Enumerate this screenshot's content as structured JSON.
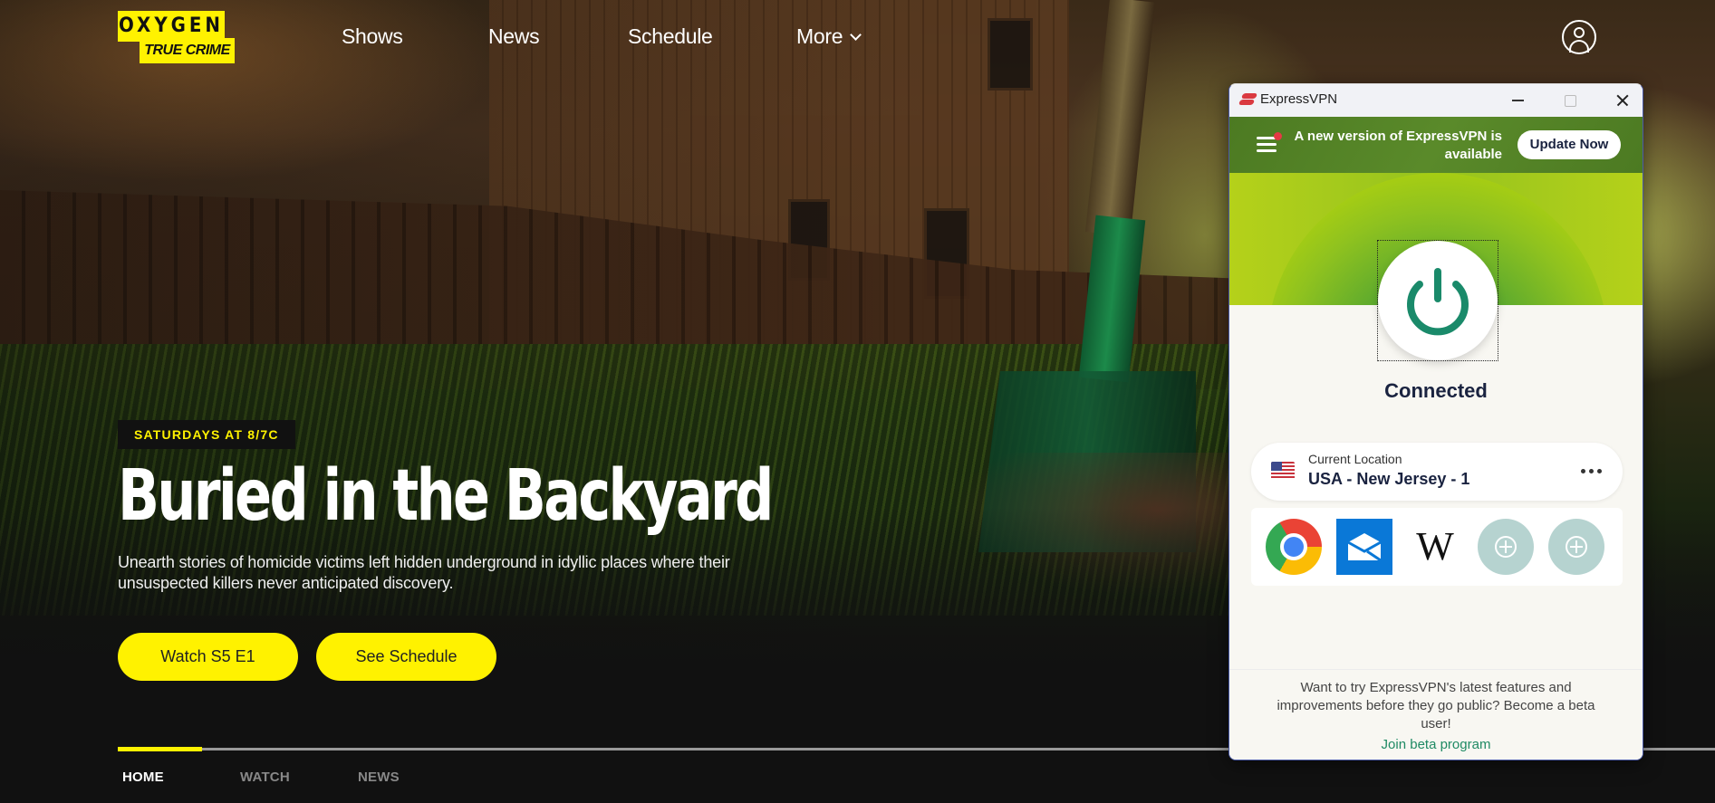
{
  "site": {
    "logo": {
      "line1": "OXYGEN",
      "line2": "TRUE CRIME",
      "color": "#fff200"
    },
    "nav": [
      {
        "label": "Shows"
      },
      {
        "label": "News"
      },
      {
        "label": "Schedule"
      },
      {
        "label": "More",
        "has_dropdown": true
      }
    ],
    "profile_icon": "user-circle-icon"
  },
  "hero": {
    "badge": "SATURDAYS AT 8/7C",
    "title": "Buried in the Backyard",
    "description": "Unearth stories of homicide victims left hidden underground in idyllic places where their unsuspected killers never anticipated discovery.",
    "buttons": [
      {
        "label": "Watch S5 E1"
      },
      {
        "label": "See Schedule"
      }
    ],
    "accent": "#fff200"
  },
  "bottom_tabs": {
    "items": [
      {
        "label": "HOME",
        "active": true
      },
      {
        "label": "WATCH",
        "active": false
      },
      {
        "label": "NEWS",
        "active": false
      }
    ],
    "progress_fraction": 0.053
  },
  "vpn": {
    "window_title": "ExpressVPN",
    "window_controls": [
      "minimize",
      "maximize",
      "close"
    ],
    "update_banner": {
      "text": "A new version of ExpressVPN is available",
      "button": "Update Now",
      "notification_dot": true
    },
    "status": "Connected",
    "location": {
      "label": "Current Location",
      "value": "USA - New Jersey - 1",
      "flag": "us-flag-icon"
    },
    "shortcuts": [
      {
        "name": "Google Chrome",
        "icon": "chrome-icon"
      },
      {
        "name": "Mail",
        "icon": "mail-icon"
      },
      {
        "name": "Wikipedia",
        "icon": "wikipedia-icon",
        "glyph": "W"
      },
      {
        "name": "Add shortcut",
        "icon": "add-icon"
      },
      {
        "name": "Add shortcut",
        "icon": "add-icon"
      }
    ],
    "beta": {
      "text": "Want to try ExpressVPN's latest features and improvements before they go public? Become a beta user!",
      "link": "Join beta program"
    },
    "colors": {
      "connected_green": "#1f8a64",
      "banner_green": "#4c7a22",
      "brand_red": "#da3940"
    }
  }
}
